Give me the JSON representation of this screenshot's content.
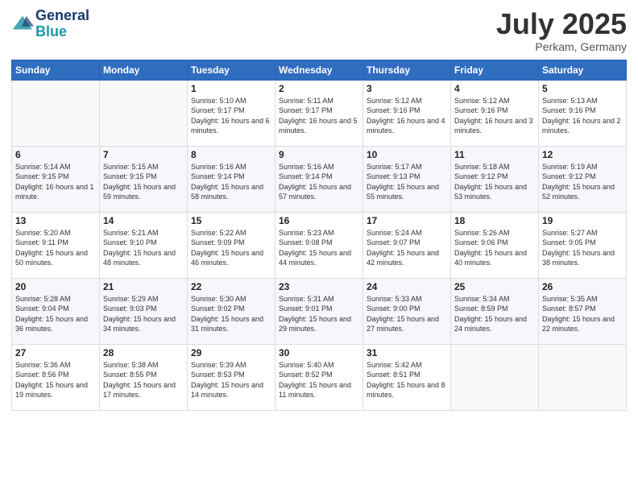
{
  "header": {
    "title": "July 2025",
    "subtitle": "Perkam, Germany"
  },
  "days": [
    "Sunday",
    "Monday",
    "Tuesday",
    "Wednesday",
    "Thursday",
    "Friday",
    "Saturday"
  ],
  "weeks": [
    [
      {
        "day": "",
        "info": ""
      },
      {
        "day": "",
        "info": ""
      },
      {
        "day": "1",
        "info": "Sunrise: 5:10 AM\nSunset: 9:17 PM\nDaylight: 16 hours and 6 minutes."
      },
      {
        "day": "2",
        "info": "Sunrise: 5:11 AM\nSunset: 9:17 PM\nDaylight: 16 hours and 5 minutes."
      },
      {
        "day": "3",
        "info": "Sunrise: 5:12 AM\nSunset: 9:16 PM\nDaylight: 16 hours and 4 minutes."
      },
      {
        "day": "4",
        "info": "Sunrise: 5:12 AM\nSunset: 9:16 PM\nDaylight: 16 hours and 3 minutes."
      },
      {
        "day": "5",
        "info": "Sunrise: 5:13 AM\nSunset: 9:16 PM\nDaylight: 16 hours and 2 minutes."
      }
    ],
    [
      {
        "day": "6",
        "info": "Sunrise: 5:14 AM\nSunset: 9:15 PM\nDaylight: 16 hours and 1 minute."
      },
      {
        "day": "7",
        "info": "Sunrise: 5:15 AM\nSunset: 9:15 PM\nDaylight: 15 hours and 59 minutes."
      },
      {
        "day": "8",
        "info": "Sunrise: 5:16 AM\nSunset: 9:14 PM\nDaylight: 15 hours and 58 minutes."
      },
      {
        "day": "9",
        "info": "Sunrise: 5:16 AM\nSunset: 9:14 PM\nDaylight: 15 hours and 57 minutes."
      },
      {
        "day": "10",
        "info": "Sunrise: 5:17 AM\nSunset: 9:13 PM\nDaylight: 15 hours and 55 minutes."
      },
      {
        "day": "11",
        "info": "Sunrise: 5:18 AM\nSunset: 9:12 PM\nDaylight: 15 hours and 53 minutes."
      },
      {
        "day": "12",
        "info": "Sunrise: 5:19 AM\nSunset: 9:12 PM\nDaylight: 15 hours and 52 minutes."
      }
    ],
    [
      {
        "day": "13",
        "info": "Sunrise: 5:20 AM\nSunset: 9:11 PM\nDaylight: 15 hours and 50 minutes."
      },
      {
        "day": "14",
        "info": "Sunrise: 5:21 AM\nSunset: 9:10 PM\nDaylight: 15 hours and 48 minutes."
      },
      {
        "day": "15",
        "info": "Sunrise: 5:22 AM\nSunset: 9:09 PM\nDaylight: 15 hours and 46 minutes."
      },
      {
        "day": "16",
        "info": "Sunrise: 5:23 AM\nSunset: 9:08 PM\nDaylight: 15 hours and 44 minutes."
      },
      {
        "day": "17",
        "info": "Sunrise: 5:24 AM\nSunset: 9:07 PM\nDaylight: 15 hours and 42 minutes."
      },
      {
        "day": "18",
        "info": "Sunrise: 5:26 AM\nSunset: 9:06 PM\nDaylight: 15 hours and 40 minutes."
      },
      {
        "day": "19",
        "info": "Sunrise: 5:27 AM\nSunset: 9:05 PM\nDaylight: 15 hours and 38 minutes."
      }
    ],
    [
      {
        "day": "20",
        "info": "Sunrise: 5:28 AM\nSunset: 9:04 PM\nDaylight: 15 hours and 36 minutes."
      },
      {
        "day": "21",
        "info": "Sunrise: 5:29 AM\nSunset: 9:03 PM\nDaylight: 15 hours and 34 minutes."
      },
      {
        "day": "22",
        "info": "Sunrise: 5:30 AM\nSunset: 9:02 PM\nDaylight: 15 hours and 31 minutes."
      },
      {
        "day": "23",
        "info": "Sunrise: 5:31 AM\nSunset: 9:01 PM\nDaylight: 15 hours and 29 minutes."
      },
      {
        "day": "24",
        "info": "Sunrise: 5:33 AM\nSunset: 9:00 PM\nDaylight: 15 hours and 27 minutes."
      },
      {
        "day": "25",
        "info": "Sunrise: 5:34 AM\nSunset: 8:59 PM\nDaylight: 15 hours and 24 minutes."
      },
      {
        "day": "26",
        "info": "Sunrise: 5:35 AM\nSunset: 8:57 PM\nDaylight: 15 hours and 22 minutes."
      }
    ],
    [
      {
        "day": "27",
        "info": "Sunrise: 5:36 AM\nSunset: 8:56 PM\nDaylight: 15 hours and 19 minutes."
      },
      {
        "day": "28",
        "info": "Sunrise: 5:38 AM\nSunset: 8:55 PM\nDaylight: 15 hours and 17 minutes."
      },
      {
        "day": "29",
        "info": "Sunrise: 5:39 AM\nSunset: 8:53 PM\nDaylight: 15 hours and 14 minutes."
      },
      {
        "day": "30",
        "info": "Sunrise: 5:40 AM\nSunset: 8:52 PM\nDaylight: 15 hours and 11 minutes."
      },
      {
        "day": "31",
        "info": "Sunrise: 5:42 AM\nSunset: 8:51 PM\nDaylight: 15 hours and 8 minutes."
      },
      {
        "day": "",
        "info": ""
      },
      {
        "day": "",
        "info": ""
      }
    ]
  ]
}
